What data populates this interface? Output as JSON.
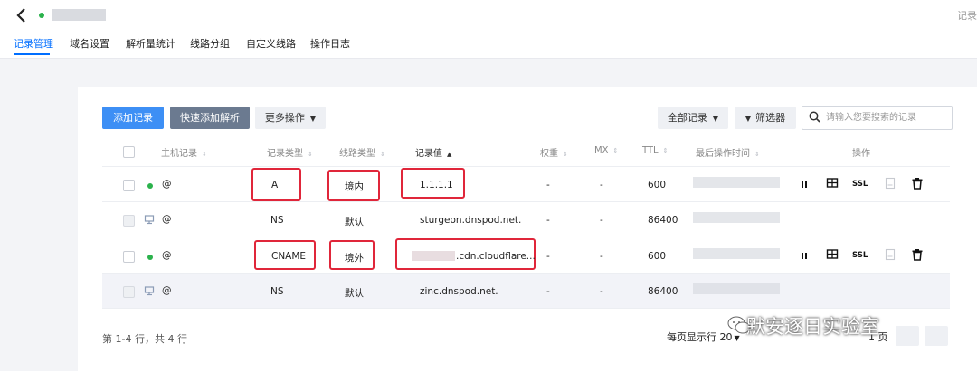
{
  "topbar": {
    "corner_text": "记录"
  },
  "tabs": [
    {
      "label": "记录管理",
      "active": true
    },
    {
      "label": "域名设置"
    },
    {
      "label": "解析量统计"
    },
    {
      "label": "线路分组"
    },
    {
      "label": "自定义线路"
    },
    {
      "label": "操作日志"
    }
  ],
  "toolbar": {
    "add_label": "添加记录",
    "quick_label": "快速添加解析",
    "more_label": "更多操作",
    "all_records_label": "全部记录",
    "filter_label": "筛选器",
    "search_placeholder": "请输入您要搜索的记录"
  },
  "table": {
    "headers": {
      "host": "主机记录",
      "type": "记录类型",
      "line": "线路类型",
      "value": "记录值",
      "weight": "权重",
      "mx": "MX",
      "ttl": "TTL",
      "time": "最后操作时间",
      "ops": "操作"
    },
    "rows": [
      {
        "host": "@",
        "type": "A",
        "line": "境内",
        "value": "1.1.1.1",
        "weight": "-",
        "mx": "-",
        "ttl": "600",
        "enabled": true,
        "has_actions": true
      },
      {
        "host": "@",
        "type": "NS",
        "line": "默认",
        "value": "sturgeon.dnspod.net.",
        "weight": "-",
        "mx": "-",
        "ttl": "86400",
        "enabled": false,
        "has_actions": false
      },
      {
        "host": "@",
        "type": "CNAME",
        "line": "境外",
        "value": ".cdn.cloudflare...",
        "weight": "-",
        "mx": "-",
        "ttl": "600",
        "enabled": true,
        "has_actions": true
      },
      {
        "host": "@",
        "type": "NS",
        "line": "默认",
        "value": "zinc.dnspod.net.",
        "weight": "-",
        "mx": "-",
        "ttl": "86400",
        "enabled": false,
        "has_actions": false
      }
    ],
    "ssl_label": "SSL"
  },
  "footer": {
    "summary": "第 1-4 行，共 4 行",
    "per_page_label": "每页显示行",
    "per_page": "20",
    "page_suffix": "1 页"
  },
  "watermark": "默安逐日实验室",
  "colors": {
    "accent": "#006eff",
    "status_on": "#2bb24c",
    "highlight_border": "#e0263a"
  }
}
